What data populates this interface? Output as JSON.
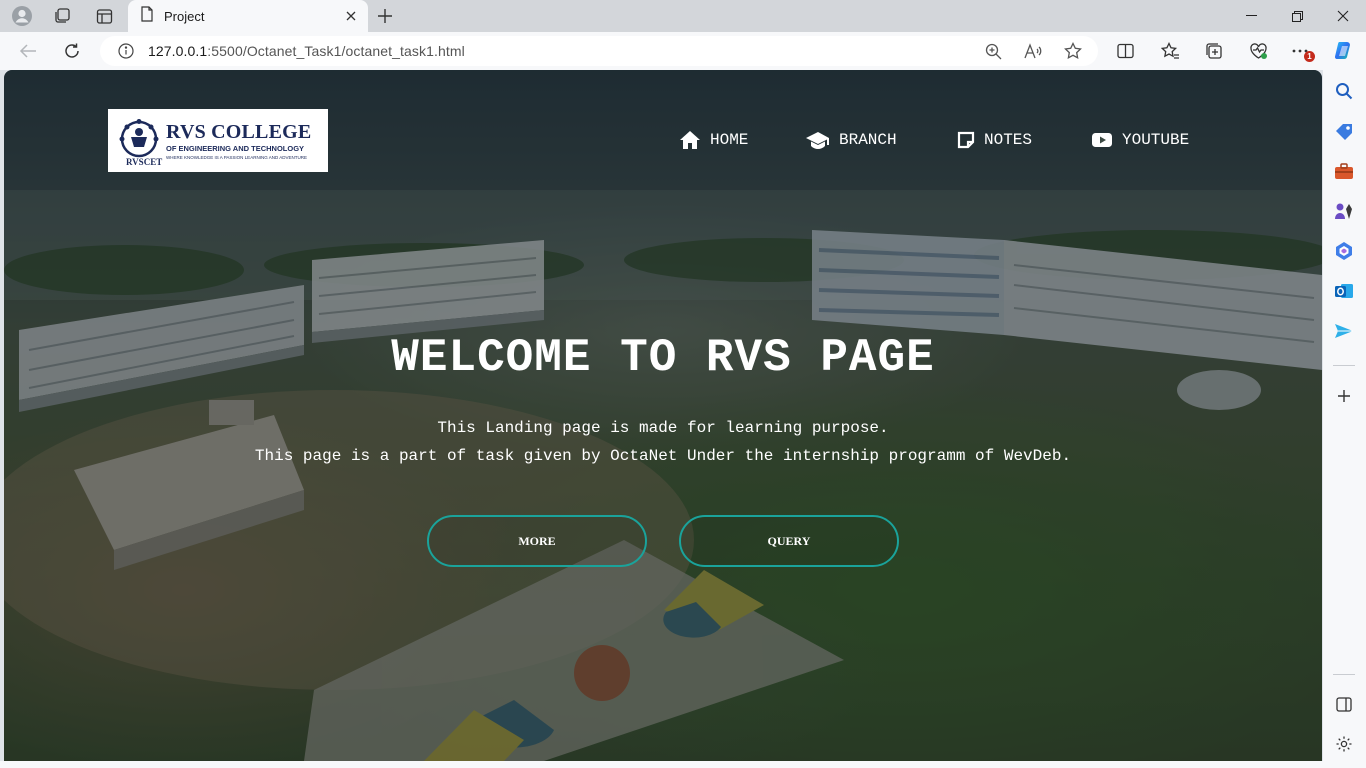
{
  "browser": {
    "tab_title": "Project",
    "url_host": "127.0.0.1",
    "url_path": ":5500/Octanet_Task1/octanet_task1.html",
    "notification_count": "1"
  },
  "page": {
    "logo": {
      "title": "RVS COLLEGE",
      "subtitle": "OF ENGINEERING AND TECHNOLOGY",
      "tagline": "WHERE KNOWLEDGE IS A PASSION LEARNING AND ADVENTURE",
      "abbr": "RVSCET"
    },
    "nav": [
      {
        "label": "HOME",
        "icon": "home-icon"
      },
      {
        "label": "BRANCH",
        "icon": "graduation-cap-icon"
      },
      {
        "label": "NOTES",
        "icon": "note-icon"
      },
      {
        "label": "YOUTUBE",
        "icon": "youtube-icon"
      }
    ],
    "hero": {
      "title": "WELCOME TO RVS PAGE",
      "line1": "This Landing page is made for learning purpose.",
      "line2": "This page is a part of task given by OctaNet Under the internship programm of WevDeb."
    },
    "buttons": {
      "more": "MORE",
      "query": "QUERY"
    }
  },
  "colors": {
    "accent_border": "#1aa39b",
    "logo_navy": "#1c2a5a"
  }
}
